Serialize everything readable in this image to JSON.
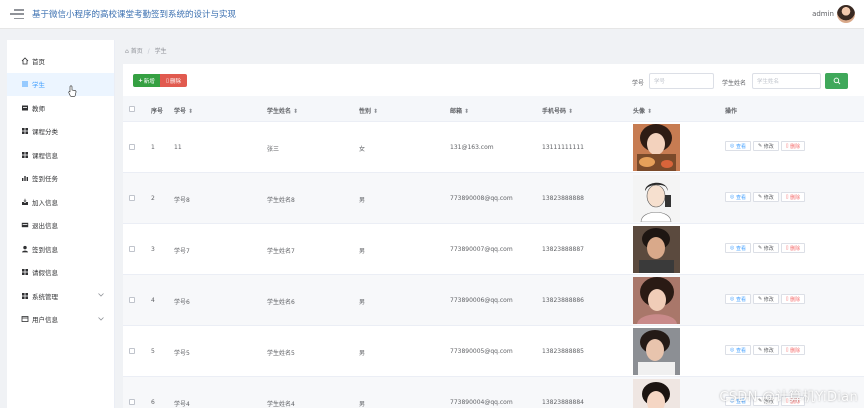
{
  "header": {
    "title": "基于微信小程序的高校课堂考勤签到系统的设计与实现",
    "user": "admin"
  },
  "sidebar": {
    "items": [
      {
        "label": "首页",
        "icon": "home-icon",
        "active": false,
        "expandable": false
      },
      {
        "label": "学生",
        "icon": "list-icon",
        "active": true,
        "expandable": false
      },
      {
        "label": "教师",
        "icon": "folder-icon",
        "active": false,
        "expandable": false
      },
      {
        "label": "课程分类",
        "icon": "grid-icon",
        "active": false,
        "expandable": false
      },
      {
        "label": "课程信息",
        "icon": "grid-icon",
        "active": false,
        "expandable": false
      },
      {
        "label": "签到任务",
        "icon": "bar-chart-icon",
        "active": false,
        "expandable": false
      },
      {
        "label": "加入信息",
        "icon": "inbox-icon",
        "active": false,
        "expandable": false
      },
      {
        "label": "退出信息",
        "icon": "card-icon",
        "active": false,
        "expandable": false
      },
      {
        "label": "签到信息",
        "icon": "user-icon",
        "active": false,
        "expandable": false
      },
      {
        "label": "请假信息",
        "icon": "grid-icon",
        "active": false,
        "expandable": false
      },
      {
        "label": "系统管理",
        "icon": "grid-icon",
        "active": false,
        "expandable": true
      },
      {
        "label": "用户信息",
        "icon": "window-icon",
        "active": false,
        "expandable": true
      }
    ]
  },
  "breadcrumb": {
    "home": "首页",
    "current": "学生"
  },
  "toolbar": {
    "add_label": "新增",
    "delete_label": "删除"
  },
  "filters": {
    "student_no_label": "学号",
    "student_no_placeholder": "学号",
    "student_name_label": "学生姓名",
    "student_name_placeholder": "学生姓名"
  },
  "table": {
    "columns": [
      "序号",
      "学号",
      "学生姓名",
      "性别",
      "邮箱",
      "手机号码",
      "头像",
      "操作"
    ],
    "actions": {
      "view": "查看",
      "edit": "修改",
      "delete": "删除"
    },
    "rows": [
      {
        "index": "1",
        "student_no": "11",
        "name": "张三",
        "gender": "女",
        "email": "131@163.com",
        "phone": "13111111111"
      },
      {
        "index": "2",
        "student_no": "学号8",
        "name": "学生姓名8",
        "gender": "男",
        "email": "773890008@qq.com",
        "phone": "13823888888"
      },
      {
        "index": "3",
        "student_no": "学号7",
        "name": "学生姓名7",
        "gender": "男",
        "email": "773890007@qq.com",
        "phone": "13823888887"
      },
      {
        "index": "4",
        "student_no": "学号6",
        "name": "学生姓名6",
        "gender": "男",
        "email": "773890006@qq.com",
        "phone": "13823888886"
      },
      {
        "index": "5",
        "student_no": "学号5",
        "name": "学生姓名5",
        "gender": "男",
        "email": "773890005@qq.com",
        "phone": "13823888885"
      },
      {
        "index": "6",
        "student_no": "学号4",
        "name": "学生姓名4",
        "gender": "男",
        "email": "773890004@qq.com",
        "phone": "13823888884"
      }
    ]
  },
  "watermark": "CSDN @计算机YiDian"
}
